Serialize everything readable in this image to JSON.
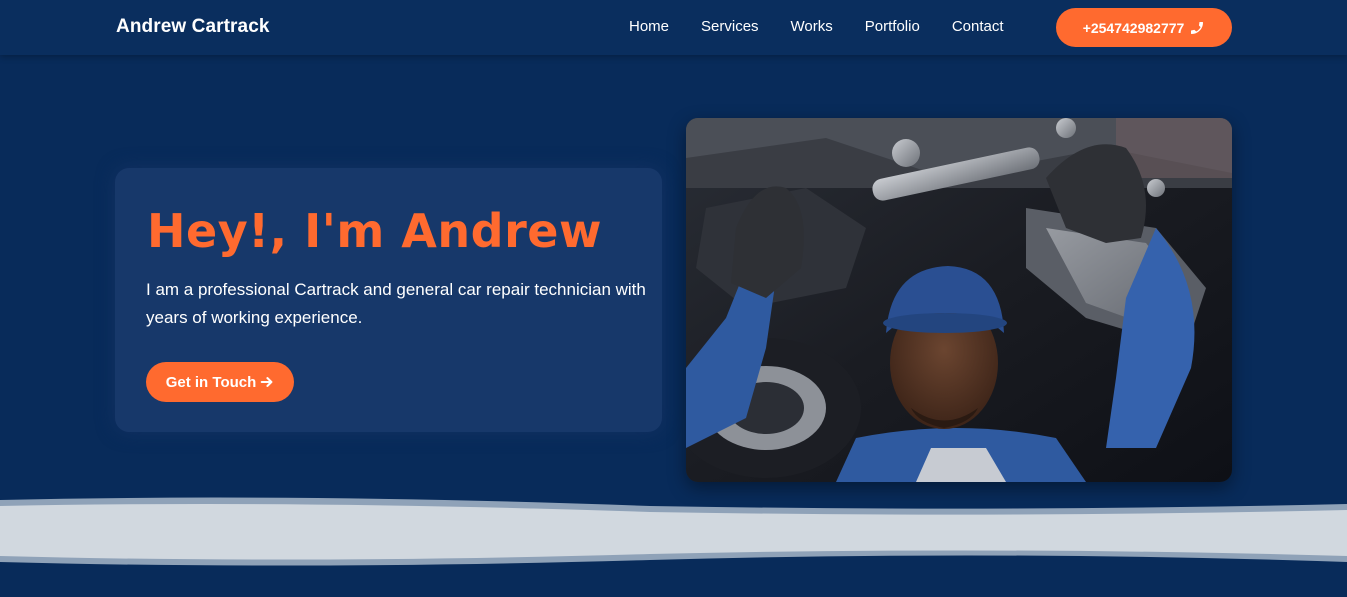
{
  "header": {
    "brand": "Andrew Cartrack",
    "nav": [
      "Home",
      "Services",
      "Works",
      "Portfolio",
      "Contact"
    ],
    "phone_label": "+254742982777",
    "phone_icon": "phone-icon"
  },
  "hero": {
    "title": "Hey!, I'm Andrew",
    "description": "I am a professional Cartrack and general car repair technician with years of working experience.",
    "cta_label": "Get in Touch",
    "cta_icon": "arrow-right-icon",
    "image_alt": "Mechanic working under a car"
  },
  "colors": {
    "background": "#082b5a",
    "accent": "#ff6a2f",
    "card": "#17386a",
    "wave": "#d1d8df"
  }
}
